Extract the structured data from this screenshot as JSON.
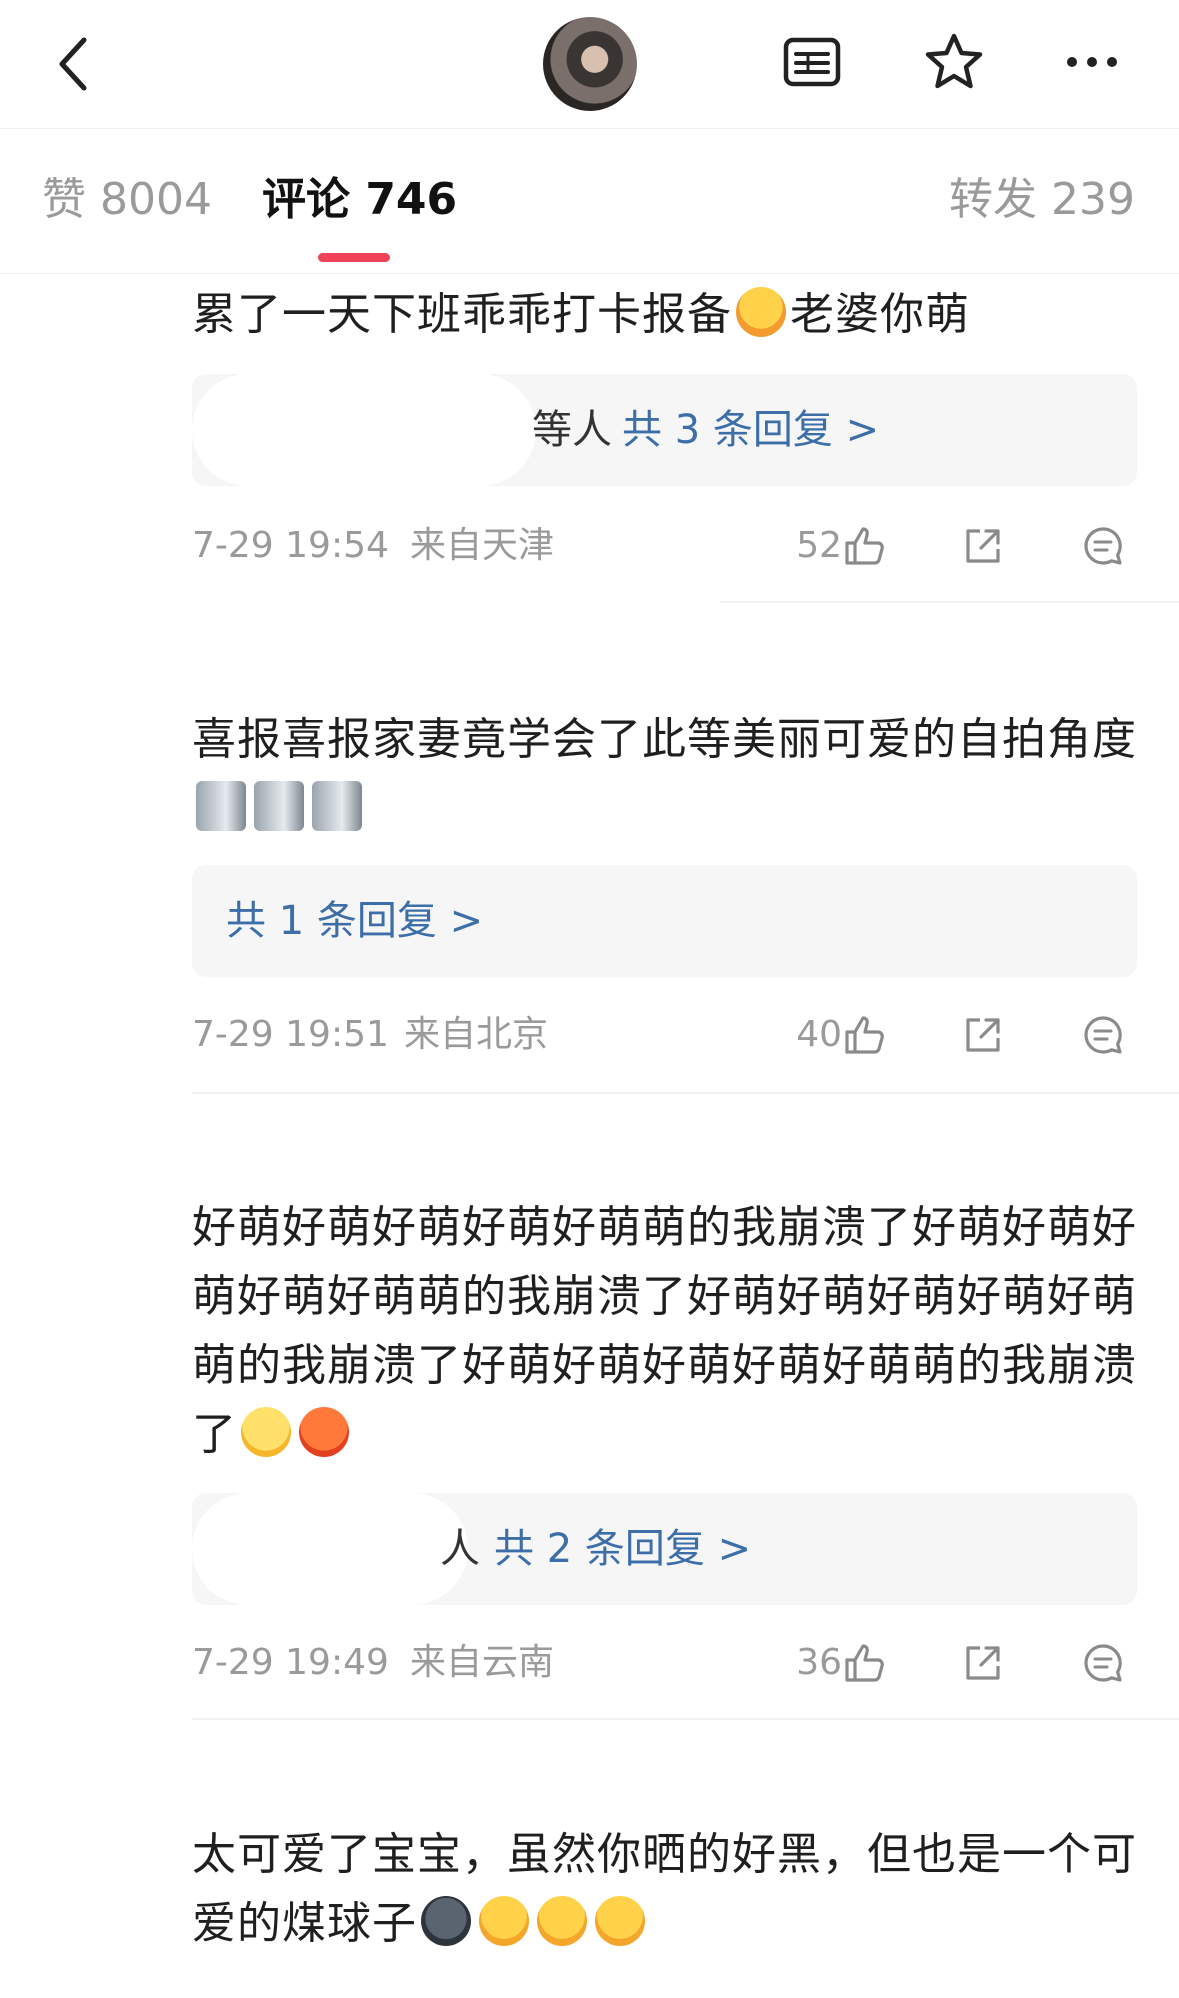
{
  "header": {
    "back_icon": "chevron-left-icon",
    "avatar_alt": "",
    "icons": [
      "list-icon",
      "star-icon",
      "more-icon"
    ]
  },
  "tabs": {
    "likes": "赞 8004",
    "comments": "评论 746",
    "reposts": "转发 239"
  },
  "colors": {
    "accent": "#f0435a",
    "link": "#3d6ea8",
    "meta": "#9a9a9a"
  },
  "comments": [
    {
      "text": "累了一天下班乖乖打卡报备",
      "text_tail": "老婆你萌",
      "emojis": [
        "hugging-emoji"
      ],
      "reply_partial": "等人",
      "reply_link": "共 3 条回复 >",
      "time": "7-29 19:54",
      "location": "来自天津",
      "likes": "52"
    },
    {
      "text": "喜报喜报家妻竟学会了此等美丽可爱的自拍角度",
      "emojis": [
        "megaphone-emoji",
        "megaphone-emoji",
        "megaphone-emoji"
      ],
      "reply_link": "共 1 条回复 >",
      "time": "7-29 19:51",
      "location": "来自北京",
      "likes": "40"
    },
    {
      "text": "好萌好萌好萌好萌好萌萌的我崩溃了好萌好萌好萌好萌好萌萌的我崩溃了好萌好萌好萌好萌好萌萌的我崩溃了好萌好萌好萌好萌好萌萌的我崩溃了",
      "emojis": [
        "tired-face-emoji",
        "angry-face-emoji"
      ],
      "reply_partial": "人",
      "reply_link": "共 2 条回复 >",
      "time": "7-29 19:49",
      "location": "来自云南",
      "likes": "36"
    },
    {
      "text": "太可爱了宝宝，虽然你晒的好黑，但也是一个可爱的煤球子",
      "emojis": [
        "new-moon-face-emoji",
        "heart-eyes-emoji",
        "heart-eyes-emoji",
        "heart-eyes-emoji"
      ]
    }
  ]
}
